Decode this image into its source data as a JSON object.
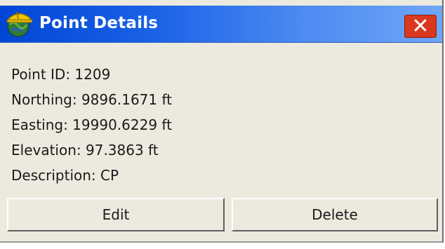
{
  "dialog": {
    "title": "Point Details",
    "close_label": "✕"
  },
  "details": {
    "point_id": "Point ID: 1209",
    "northing": "Northing: 9896.1671 ft",
    "easting": "Easting: 19990.6229 ft",
    "elevation": "Elevation: 97.3863 ft",
    "description": "Description: CP"
  },
  "buttons": {
    "edit_label": "Edit",
    "delete_label": "Delete"
  },
  "colors": {
    "titlebar_start": "#0046d6",
    "titlebar_end": "#6fa6f7",
    "close_button": "#d9381e",
    "dialog_background": "#eceadf"
  },
  "icons": {
    "title": "hard-hat-globe-icon",
    "close": "close-icon"
  }
}
